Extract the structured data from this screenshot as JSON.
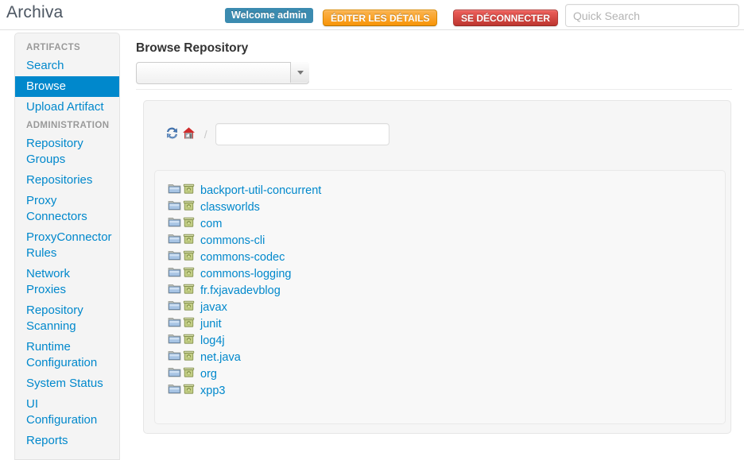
{
  "header": {
    "brand": "Archiva",
    "welcome_badge": "Welcome admin",
    "edit_details_label": "ÉDITER LES DÉTAILS",
    "logout_label": "SE DÉCONNECTER",
    "search_placeholder": "Quick Search",
    "search_value": "",
    "accent_orange": "#f89406",
    "accent_red": "#bd362f",
    "badge_blue": "#3b8bb0"
  },
  "sidebar": {
    "groups": [
      {
        "header": "ARTIFACTS",
        "items": [
          {
            "label": "Search",
            "active": false
          },
          {
            "label": "Browse",
            "active": true
          },
          {
            "label": "Upload Artifact",
            "active": false
          }
        ]
      },
      {
        "header": "ADMINISTRATION",
        "items": [
          {
            "label": "Repository Groups",
            "active": false
          },
          {
            "label": "Repositories",
            "active": false
          },
          {
            "label": "Proxy Connectors",
            "active": false
          },
          {
            "label": "ProxyConnector Rules",
            "active": false
          },
          {
            "label": "Network Proxies",
            "active": false
          },
          {
            "label": "Repository Scanning",
            "active": false
          },
          {
            "label": "Runtime Configuration",
            "active": false
          },
          {
            "label": "System Status",
            "active": false
          },
          {
            "label": "UI Configuration",
            "active": false
          },
          {
            "label": "Reports",
            "active": false
          }
        ]
      }
    ],
    "active_color": "#0088cc"
  },
  "main": {
    "page_title": "Browse Repository",
    "repository_select": {
      "value": "",
      "options": []
    },
    "path_bar": {
      "refresh_icon": "refresh-icon",
      "home_icon": "home-icon",
      "separator": "/",
      "path_value": "",
      "path_placeholder": ""
    },
    "tree": {
      "items": [
        {
          "label": "backport-util-concurrent"
        },
        {
          "label": "classworlds"
        },
        {
          "label": "com"
        },
        {
          "label": "commons-cli"
        },
        {
          "label": "commons-codec"
        },
        {
          "label": "commons-logging"
        },
        {
          "label": "fr.fxjavadevblog"
        },
        {
          "label": "javax"
        },
        {
          "label": "junit"
        },
        {
          "label": "log4j"
        },
        {
          "label": "net.java"
        },
        {
          "label": "org"
        },
        {
          "label": "xpp3"
        }
      ],
      "link_color": "#0088cc"
    }
  }
}
